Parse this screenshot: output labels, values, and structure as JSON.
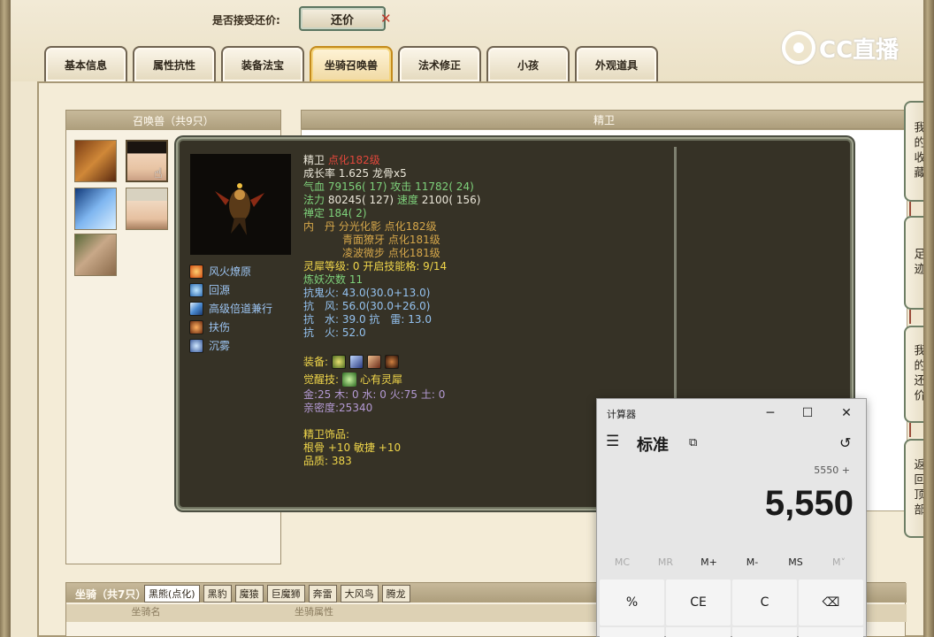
{
  "header": {
    "offer_label": "是否接受还价:",
    "offer_button": "还价",
    "logo_text": "CC直播"
  },
  "tabs": [
    {
      "label": "基本信息"
    },
    {
      "label": "属性抗性"
    },
    {
      "label": "装备法宝"
    },
    {
      "label": "坐骑召唤兽",
      "active": true
    },
    {
      "label": "法术修正"
    },
    {
      "label": "小孩"
    },
    {
      "label": "外观道具"
    }
  ],
  "summons": {
    "title": "召唤兽（共9只）",
    "detail_title": "精卫"
  },
  "tooltip": {
    "name": "精卫",
    "level": "点化182级",
    "growth": "成长率 1.625 龙骨x5",
    "hp_label": "气血",
    "hp_value": "79156( 17)",
    "atk_label": "攻击",
    "atk_value": "11782( 24)",
    "mp_label": "法力",
    "mp_value": "80245( 127)",
    "spd_label": "速度",
    "spd_value": "2100( 156)",
    "zen_label": "禅定",
    "zen_value": "184( 2)",
    "neidan_label": "内　丹",
    "neidan_1": "分光化影 点化182级",
    "neidan_2": "青面獠牙 点化181级",
    "neidan_3": "凌波微步 点化181级",
    "lingxi_label": "灵犀等级:",
    "lingxi_value": "0 开启技能格: 9/14",
    "lianyao": "炼妖次数 11",
    "res_1": "抗鬼火: 43.0(30.0+13.0)",
    "res_2": "抗　风: 56.0(30.0+26.0)",
    "res_3": "抗　水: 39.0 抗　雷: 13.0",
    "res_4": "抗　火: 52.0",
    "equip_label": "装备:",
    "awaken_label": "觉醒技:",
    "awaken_value": "心有灵犀",
    "elements": "金:25 木: 0 水: 0 火:75 土: 0",
    "intimacy": "亲密度:25340",
    "accessory_label": "精卫饰品:",
    "accessory_stats": "根骨 +10 敏捷 +10",
    "accessory_quality": "品质: 383",
    "skills": [
      {
        "name": "风火燎原",
        "icon": "fire-skill-icon"
      },
      {
        "name": "回源",
        "icon": "water-skill-icon"
      },
      {
        "name": "高级倍道兼行",
        "icon": "speed-skill-icon"
      },
      {
        "name": "扶伤",
        "icon": "heal-skill-icon"
      },
      {
        "name": "沉雾",
        "icon": "fog-skill-icon"
      }
    ]
  },
  "mounts": {
    "title": "坐骑（共7只）",
    "tabs": [
      "黑熊(点化)",
      "黑豹",
      "魔猿",
      "巨魔狮",
      "奔雷",
      "大风鸟",
      "腾龙"
    ],
    "col_name": "坐骑名",
    "col_attr": "坐骑属性"
  },
  "side_buttons": [
    {
      "label": "我的收藏"
    },
    {
      "label": "足迹"
    },
    {
      "label": "我的还价"
    },
    {
      "label": "返回顶部"
    }
  ],
  "calculator": {
    "title": "计算器",
    "mode": "标准",
    "expression": "5550 +",
    "display": "5,550",
    "memory": [
      "MC",
      "MR",
      "M+",
      "M-",
      "MS",
      "M˅"
    ],
    "keys": [
      "%",
      "CE",
      "C",
      "⌫"
    ]
  },
  "colors": {
    "tab_active_border": "#c48b1c",
    "tooltip_bg": "#363226",
    "level_red": "#e2473b",
    "stat_green": "#7ed17b"
  }
}
